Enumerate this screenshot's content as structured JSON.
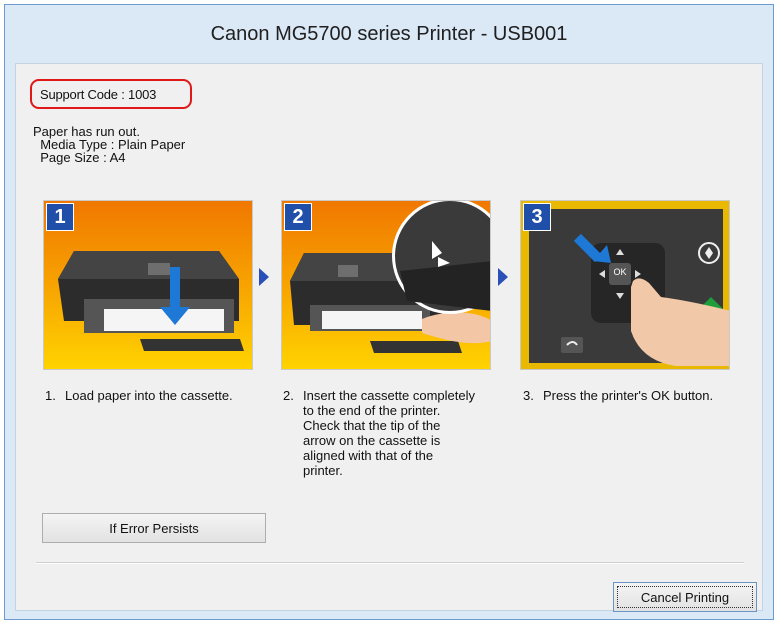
{
  "window": {
    "title": "Canon MG5700 series Printer - USB001"
  },
  "support": {
    "label": "Support Code : 1003",
    "highlight_color": "#e01818"
  },
  "message": {
    "line1": "Paper has run out.",
    "line2": "  Media Type : Plain Paper",
    "line3": "  Page Size : A4"
  },
  "steps": [
    {
      "badge": "1",
      "number": "1.",
      "text": "Load paper into the cassette."
    },
    {
      "badge": "2",
      "number": "2.",
      "text": "Insert the cassette completely\nto the end of the printer.\nCheck that the tip of the\narrow on the cassette is\naligned with that of the\nprinter."
    },
    {
      "badge": "3",
      "number": "3.",
      "text": "Press the printer's OK button."
    }
  ],
  "panel": {
    "ok_label": "OK"
  },
  "buttons": {
    "if_error_persists": "If Error Persists",
    "cancel_printing": "Cancel Printing"
  },
  "colors": {
    "badge_blue": "#1f4fa8",
    "separator_arrow": "#2a4fb8"
  }
}
